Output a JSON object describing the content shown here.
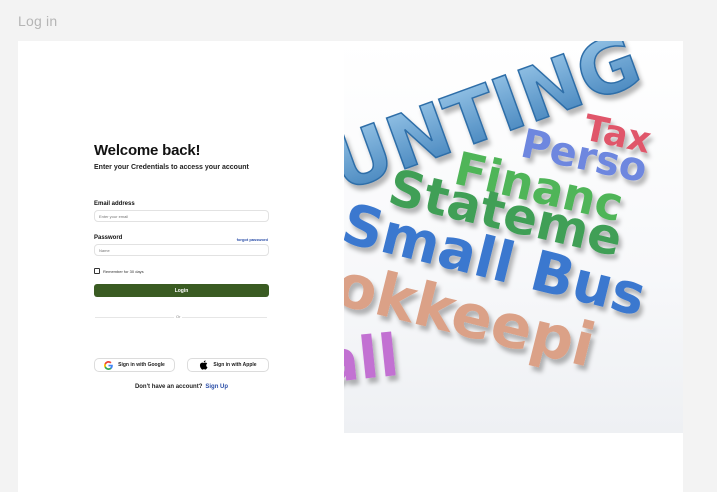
{
  "page": {
    "label": "Log in"
  },
  "form": {
    "title": "Welcome back!",
    "subtitle": "Enter your Credentials to access your account",
    "email": {
      "label": "Email address",
      "placeholder": "Enter your email",
      "value": ""
    },
    "password": {
      "label": "Password",
      "placeholder": "Name",
      "value": "",
      "forgot_label": "forgot password"
    },
    "remember": {
      "label": "Remember for 30 days",
      "checked": false
    },
    "login_label": "Login",
    "divider_label": "Or",
    "google_label": "Sign in with Google",
    "apple_label": "Sign in with Apple",
    "signup_prompt": "Don't have an account?",
    "signup_link": "Sign Up"
  },
  "hero": {
    "words": [
      "UNTING",
      "Tax",
      "Perso",
      "Financ",
      "Stateme",
      "Small Bus",
      "okkeepi",
      "all"
    ]
  },
  "colors": {
    "primary": "#3a5b22",
    "link": "#2b4ea8"
  },
  "icons": {
    "google": "google-icon",
    "apple": "apple-icon",
    "checkbox": "checkbox-icon"
  }
}
